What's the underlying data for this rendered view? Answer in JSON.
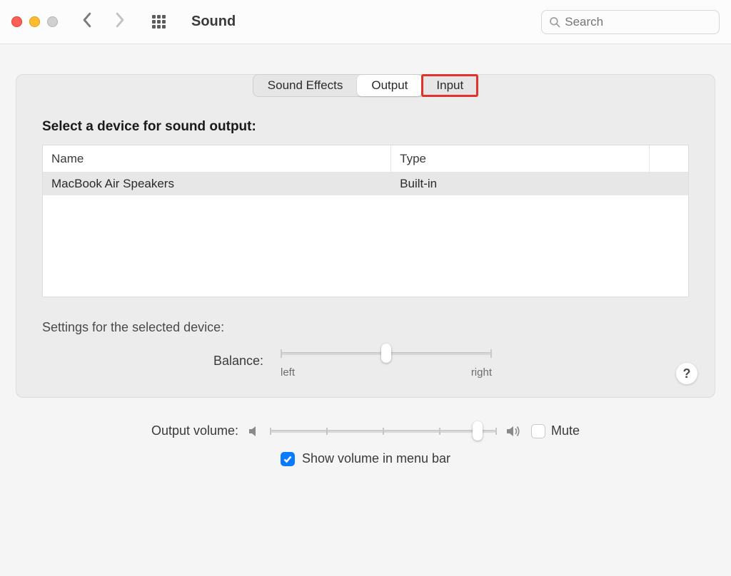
{
  "titlebar": {
    "title": "Sound",
    "search_placeholder": "Search"
  },
  "tabs": {
    "sound_effects": "Sound Effects",
    "output": "Output",
    "input": "Input",
    "active": "output",
    "highlighted": "input"
  },
  "output": {
    "heading": "Select a device for sound output:",
    "columns": {
      "name": "Name",
      "type": "Type"
    },
    "devices": [
      {
        "name": "MacBook Air Speakers",
        "type": "Built-in"
      }
    ],
    "settings_heading": "Settings for the selected device:",
    "balance": {
      "label": "Balance:",
      "left": "left",
      "right": "right",
      "value": 0.5
    }
  },
  "volume": {
    "label": "Output volume:",
    "value": 0.92,
    "mute_label": "Mute",
    "mute_checked": false,
    "menubar_label": "Show volume in menu bar",
    "menubar_checked": true
  },
  "help_label": "?"
}
